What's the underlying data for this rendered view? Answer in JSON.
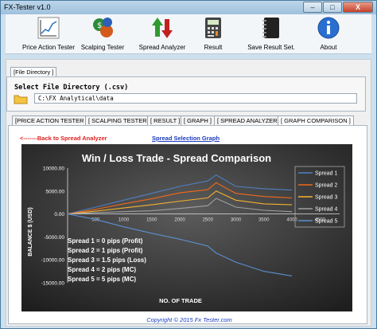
{
  "window": {
    "title": "FX-Tester v1.0",
    "minimize": "–",
    "maximize": "□",
    "close": "X"
  },
  "toolbar": {
    "items": [
      {
        "label": "Price Action Tester",
        "icon": "line-chart-icon"
      },
      {
        "label": "Scalping Tester",
        "icon": "dollar-gears-icon"
      },
      {
        "label": "Spread Analyzer",
        "icon": "up-down-arrows-icon"
      },
      {
        "label": "Result",
        "icon": "calculator-icon"
      },
      {
        "label": "Save Result Set.",
        "icon": "notebook-icon"
      },
      {
        "label": "About",
        "icon": "info-icon"
      }
    ]
  },
  "file_directory": {
    "tab": "[File Directory ]",
    "label": "Select File Directory (.csv)",
    "path": "C:\\FX Analytical\\data"
  },
  "tabs": [
    "[PRICE ACTION TESTER ]",
    "[ SCALPING TESTER ]",
    "[ RESULT ]",
    "[ GRAPH ]",
    "[ SPREAD ANALYZER ]",
    "[ GRAPH COMPARISON ]"
  ],
  "links": {
    "back": "<-------Back to Spread Analyzer",
    "selection": "Spread Selection Graph"
  },
  "chart_data": {
    "type": "line",
    "title": "Win / Loss Trade - Spread Comparison",
    "xlabel": "NO. OF TRADE",
    "ylabel": "BALANCE $ (USD)",
    "xlim": [
      0,
      4000
    ],
    "ylim": [
      -15000,
      10000
    ],
    "x_ticks": [
      "500",
      "1000",
      "1500",
      "2000",
      "2500",
      "3000",
      "3500",
      "4000",
      "4500"
    ],
    "y_ticks": [
      "10000.00",
      "5000.00",
      "0.00",
      "-5000.00",
      "-10000.00",
      "-15000.00"
    ],
    "x": [
      0,
      500,
      1000,
      1500,
      2000,
      2500,
      2650,
      3000,
      3500,
      4000
    ],
    "series": [
      {
        "name": "Spread 1",
        "color": "#4f7fc4",
        "values": [
          0,
          1500,
          3000,
          4500,
          6000,
          7200,
          8500,
          6000,
          5500,
          5200
        ]
      },
      {
        "name": "Spread 2",
        "color": "#f06a1a",
        "values": [
          0,
          1000,
          2200,
          3300,
          4600,
          5300,
          6800,
          4500,
          3800,
          3500
        ]
      },
      {
        "name": "Spread 3",
        "color": "#f5b030",
        "values": [
          0,
          600,
          1300,
          2000,
          2800,
          3500,
          5000,
          3000,
          2200,
          2000
        ]
      },
      {
        "name": "Spread 4",
        "color": "#a0a0a0",
        "values": [
          0,
          300,
          500,
          700,
          1200,
          1800,
          3400,
          1500,
          800,
          500
        ]
      },
      {
        "name": "Spread 5",
        "color": "#5b8fd0",
        "values": [
          0,
          -1200,
          -2800,
          -4200,
          -5500,
          -7000,
          -8500,
          -10500,
          -12500,
          -13500
        ]
      }
    ],
    "annotations": [
      "Spread 1 = 0 pips (Profit)",
      "Spread 2 = 1 pips (Profit)",
      "Spread 3 = 1.5 pips (Loss)",
      "Spread 4 = 2 pips (MC)",
      "Spread 5 = 5 pips (MC)"
    ],
    "legend": "top-right",
    "grid": false
  },
  "footer": {
    "copyright": "Copyright © 2015 Fx Tester.com"
  }
}
